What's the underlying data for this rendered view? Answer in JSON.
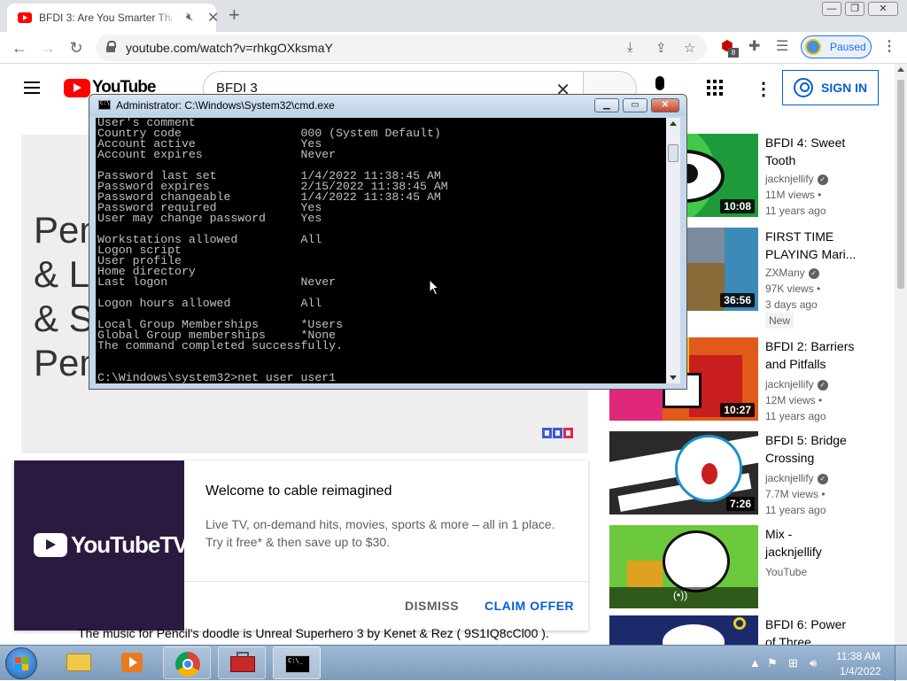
{
  "browser": {
    "tab_title": "BFDI 3: Are You Smarter Than",
    "tab_audio_icon": "speaker-muted-icon",
    "url": "youtube.com/watch?v=rhkgOXksmaY",
    "profile_label": "Paused",
    "extension_badge": "8"
  },
  "youtube": {
    "logo": "YouTube",
    "search_query": "BFDI 3",
    "signin_label": "SIGN IN",
    "player_lines": [
      "Pen",
      "& Le",
      "& S",
      "Pen"
    ],
    "ad": {
      "logo_text": "YouTubeTV",
      "title": "Welcome to cable reimagined",
      "desc_line1": "Live TV, on-demand hits, movies, sports & more – all in 1 place.",
      "desc_line2": "Try it free* & then save up to $30.",
      "dismiss": "DISMISS",
      "claim": "CLAIM OFFER"
    },
    "description_line": "The music for Pencil's doodle is Unreal Superhero 3 by Kenet & Rez ( 9S1IQ8cCl00 ).",
    "recommendations": [
      {
        "title_line1": "BFDI 4: Sweet",
        "title_line2": "Tooth",
        "channel": "jacknjellify",
        "views": "11M views •",
        "age": "11 years ago",
        "duration": "10:08"
      },
      {
        "title_line1": "FIRST TIME",
        "title_line2": "PLAYING Mari...",
        "channel": "ZXMany",
        "views": "97K views •",
        "age": "3 days ago",
        "duration": "36:56",
        "badge": "New"
      },
      {
        "title_line1": "BFDI 2: Barriers",
        "title_line2": "and Pitfalls",
        "channel": "jacknjellify",
        "views": "12M views •",
        "age": "11 years ago",
        "duration": "10:27"
      },
      {
        "title_line1": "BFDI 5: Bridge",
        "title_line2": "Crossing",
        "channel": "jacknjellify",
        "views": "7.7M views •",
        "age": "11 years ago",
        "duration": "7:26"
      },
      {
        "title_line1": "Mix -",
        "title_line2": "jacknjellify",
        "channel": "YouTube",
        "live_icon": "(•))"
      },
      {
        "title_line1": "BFDI 6: Power",
        "title_line2": "of Three"
      }
    ]
  },
  "cmd": {
    "title": "Administrator: C:\\Windows\\System32\\cmd.exe",
    "lines": [
      "User's comment",
      "Country code                 000 (System Default)",
      "Account active               Yes",
      "Account expires              Never",
      "",
      "Password last set            1/4/2022 11:38:45 AM",
      "Password expires             2/15/2022 11:38:45 AM",
      "Password changeable          1/4/2022 11:38:45 AM",
      "Password required            Yes",
      "User may change password     Yes",
      "",
      "Workstations allowed         All",
      "Logon script",
      "User profile",
      "Home directory",
      "Last logon                   Never",
      "",
      "Logon hours allowed          All",
      "",
      "Local Group Memberships      *Users",
      "Global Group memberships     *None",
      "The command completed successfully.",
      "",
      "",
      "C:\\Windows\\system32>net user user1"
    ]
  },
  "taskbar": {
    "time": "11:38 AM",
    "date": "1/4/2022",
    "items": [
      "file-explorer-icon",
      "media-player-icon",
      "chrome-icon",
      "toolbox-icon",
      "cmd-icon"
    ]
  }
}
